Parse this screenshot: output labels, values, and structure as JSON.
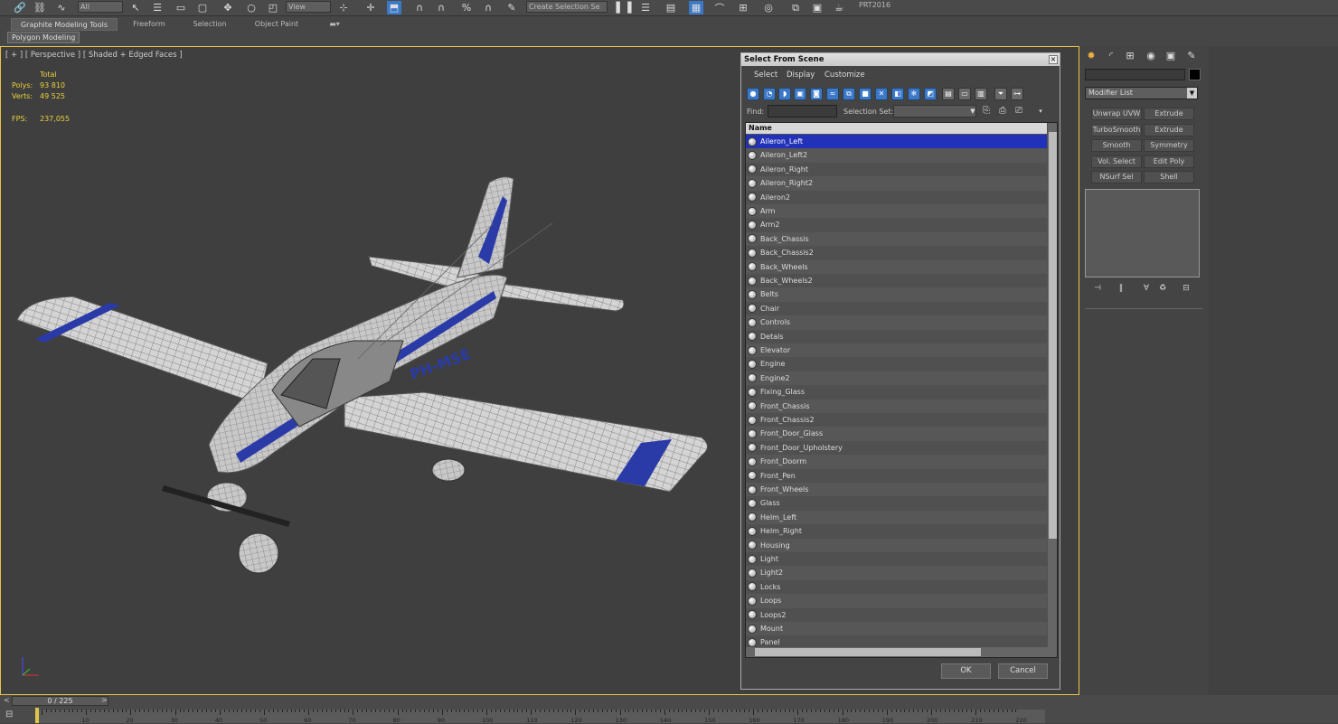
{
  "toolbar": {
    "selection_filter": "All",
    "ref_coord": "View",
    "named_selection": "Create Selection Se",
    "app_label": "PRT2016"
  },
  "ribbon": {
    "tabs": [
      "Graphite Modeling Tools",
      "Freeform",
      "Selection",
      "Object Paint"
    ],
    "active_tab": "Graphite Modeling Tools",
    "panel": "Polygon Modeling"
  },
  "viewport": {
    "label": "[ + ] [ Perspective ] [ Shaded + Edged Faces ]",
    "stats": {
      "header": "Total",
      "polys_label": "Polys:",
      "polys": "93 810",
      "verts_label": "Verts:",
      "verts": "49 525",
      "fps_label": "FPS:",
      "fps": "237,055"
    },
    "registration_text": "PH-MSE",
    "border_color": "#e9c44a"
  },
  "dialog": {
    "title": "Select From Scene",
    "menu": [
      "Select",
      "Display",
      "Customize"
    ],
    "find_label": "Find:",
    "find_value": "",
    "selection_set_label": "Selection Set:",
    "column_header": "Name",
    "items": [
      "Aileron_Left",
      "Aileron_Left2",
      "Aileron_Right",
      "Aileron_Right2",
      "Aileron2",
      "Arm",
      "Arm2",
      "Back_Chassis",
      "Back_Chassis2",
      "Back_Wheels",
      "Back_Wheels2",
      "Belts",
      "Chair",
      "Controls",
      "Detals",
      "Elevator",
      "Engine",
      "Engine2",
      "Fixing_Glass",
      "Front_Chassis",
      "Front_Chassis2",
      "Front_Door_Glass",
      "Front_Door_Upholstery",
      "Front_Doorm",
      "Front_Pen",
      "Front_Wheels",
      "Glass",
      "Helm_Left",
      "Helm_Right",
      "Housing",
      "Light",
      "Light2",
      "Locks",
      "Loops",
      "Loops2",
      "Mount",
      "Panel"
    ],
    "selected_index": 0,
    "ok_label": "OK",
    "cancel_label": "Cancel",
    "selection_color": "#2132b8"
  },
  "command_panel": {
    "modifier_list": "Modifier List",
    "buttons": [
      "Unwrap UVW",
      "Extrude",
      "TurboSmooth",
      "Extrude",
      "Smooth",
      "Symmetry",
      "Vol. Select",
      "Edit Poly",
      "NSurf Sel",
      "Shell"
    ]
  },
  "timeline": {
    "slider": "0 / 225",
    "ticks": [
      "10",
      "20",
      "30",
      "40",
      "50",
      "60",
      "70",
      "80",
      "90",
      "100",
      "110",
      "120",
      "130",
      "140",
      "150",
      "160",
      "170",
      "180",
      "190",
      "200",
      "210",
      "220"
    ]
  }
}
